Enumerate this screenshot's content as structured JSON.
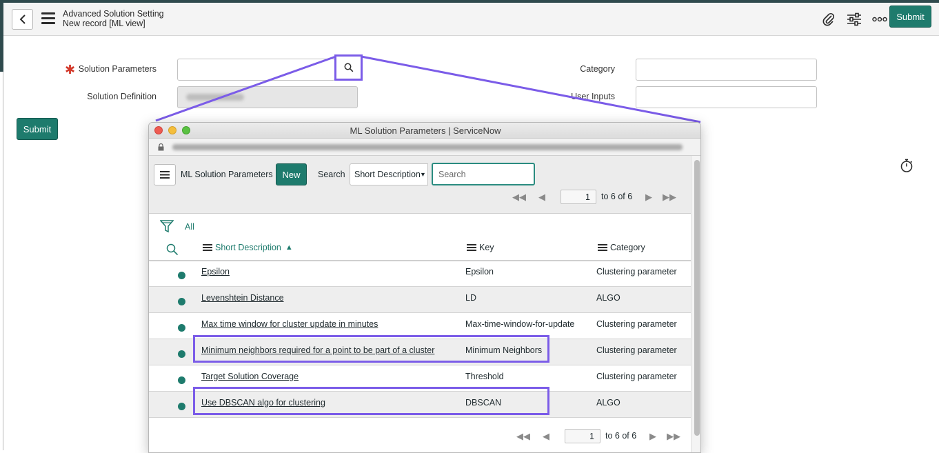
{
  "header": {
    "title": "Advanced Solution Setting",
    "subtitle": "New record [ML view]",
    "submit_label": "Submit"
  },
  "form": {
    "solution_parameters_label": "Solution Parameters",
    "solution_definition_label": "Solution Definition",
    "category_label": "Category",
    "user_inputs_label": "User Inputs",
    "submit_label": "Submit",
    "required_mark": "✱"
  },
  "popup": {
    "window_title": "ML Solution Parameters | ServiceNow",
    "list_title": "ML Solution Parameters",
    "new_label": "New",
    "search_label": "Search",
    "search_field": "Short Description",
    "search_placeholder": "Search",
    "page_value": "1",
    "page_total": "to 6 of 6",
    "filter_label": "All",
    "columns": {
      "short_description": "Short Description",
      "key": "Key",
      "category": "Category"
    },
    "rows": [
      {
        "desc": "Epsilon",
        "key": "Epsilon",
        "category": "Clustering parameter"
      },
      {
        "desc": "Levenshtein Distance",
        "key": "LD",
        "category": "ALGO"
      },
      {
        "desc": "Max time window for cluster update in minutes",
        "key": "Max-time-window-for-update",
        "category": "Clustering parameter"
      },
      {
        "desc": "Minimum neighbors required for a point to be part of a cluster",
        "key": "Minimum Neighbors",
        "category": "Clustering parameter"
      },
      {
        "desc": "Target Solution Coverage",
        "key": "Threshold",
        "category": "Clustering parameter"
      },
      {
        "desc": "Use DBSCAN algo for clustering",
        "key": "DBSCAN",
        "category": "ALGO"
      }
    ]
  },
  "colors": {
    "accent": "#1e7b6d",
    "highlight": "#7b5ce8",
    "required": "#d33a2c"
  }
}
